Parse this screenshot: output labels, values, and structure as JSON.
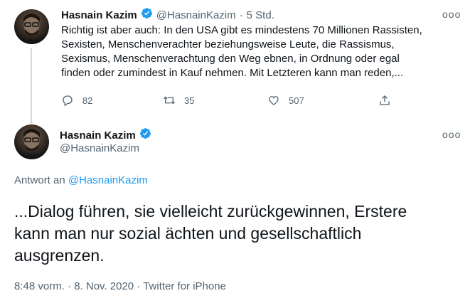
{
  "tweet1": {
    "name": "Hasnain Kazim",
    "handle": "@HasnainKazim",
    "separator": "·",
    "time": "5 Std.",
    "more": "ooo",
    "text_lines": [
      "Richtig ist aber auch: In den USA gibt es mindestens 70 Millionen Rassisten,",
      "Sexisten, Menschenverachter beziehungsweise Leute, die Rassismus,",
      "Sexismus, Menschenverachtung den Weg ebnen, in Ordnung oder egal",
      "finden oder zumindest in Kauf nehmen. Mit Letzteren kann man reden,..."
    ],
    "replies": "82",
    "retweets": "35",
    "likes": "507"
  },
  "tweet2": {
    "name": "Hasnain Kazim",
    "handle": "@HasnainKazim",
    "more": "ooo",
    "reply_prefix": "Antwort an",
    "reply_handle": "@HasnainKazim",
    "text_lines": [
      "...Dialog führen, sie vielleicht zurückgewinnen, Erstere",
      "kann man nur sozial ächten und gesellschaftlich",
      "ausgrenzen."
    ],
    "meta": "8:48 vorm. · 8. Nov. 2020 · Twitter for iPhone"
  },
  "colors": {
    "verified": "#1d9bf0",
    "secondary_text": "#536471",
    "link": "#1d9bf0"
  },
  "icons": [
    "verified-badge-icon",
    "more-icon",
    "reply-icon",
    "retweet-icon",
    "like-icon",
    "share-icon"
  ]
}
